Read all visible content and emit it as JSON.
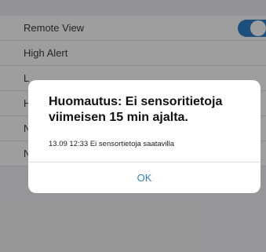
{
  "settings": {
    "rows": [
      {
        "label": "Remote View",
        "toggle": "on"
      },
      {
        "label": "High Alert"
      },
      {
        "label": "L"
      },
      {
        "label": "H"
      },
      {
        "label": "N"
      },
      {
        "label": "N"
      }
    ]
  },
  "alert": {
    "title": "Huomautus: Ei sensoritietoja viimeisen 15 min ajalta.",
    "message": "13.09 12:33 Ei sensortietoja saatavilla",
    "ok_label": "OK"
  },
  "colors": {
    "accent": "#2f80c8",
    "overlay": "rgba(0,0,0,0.38)"
  }
}
